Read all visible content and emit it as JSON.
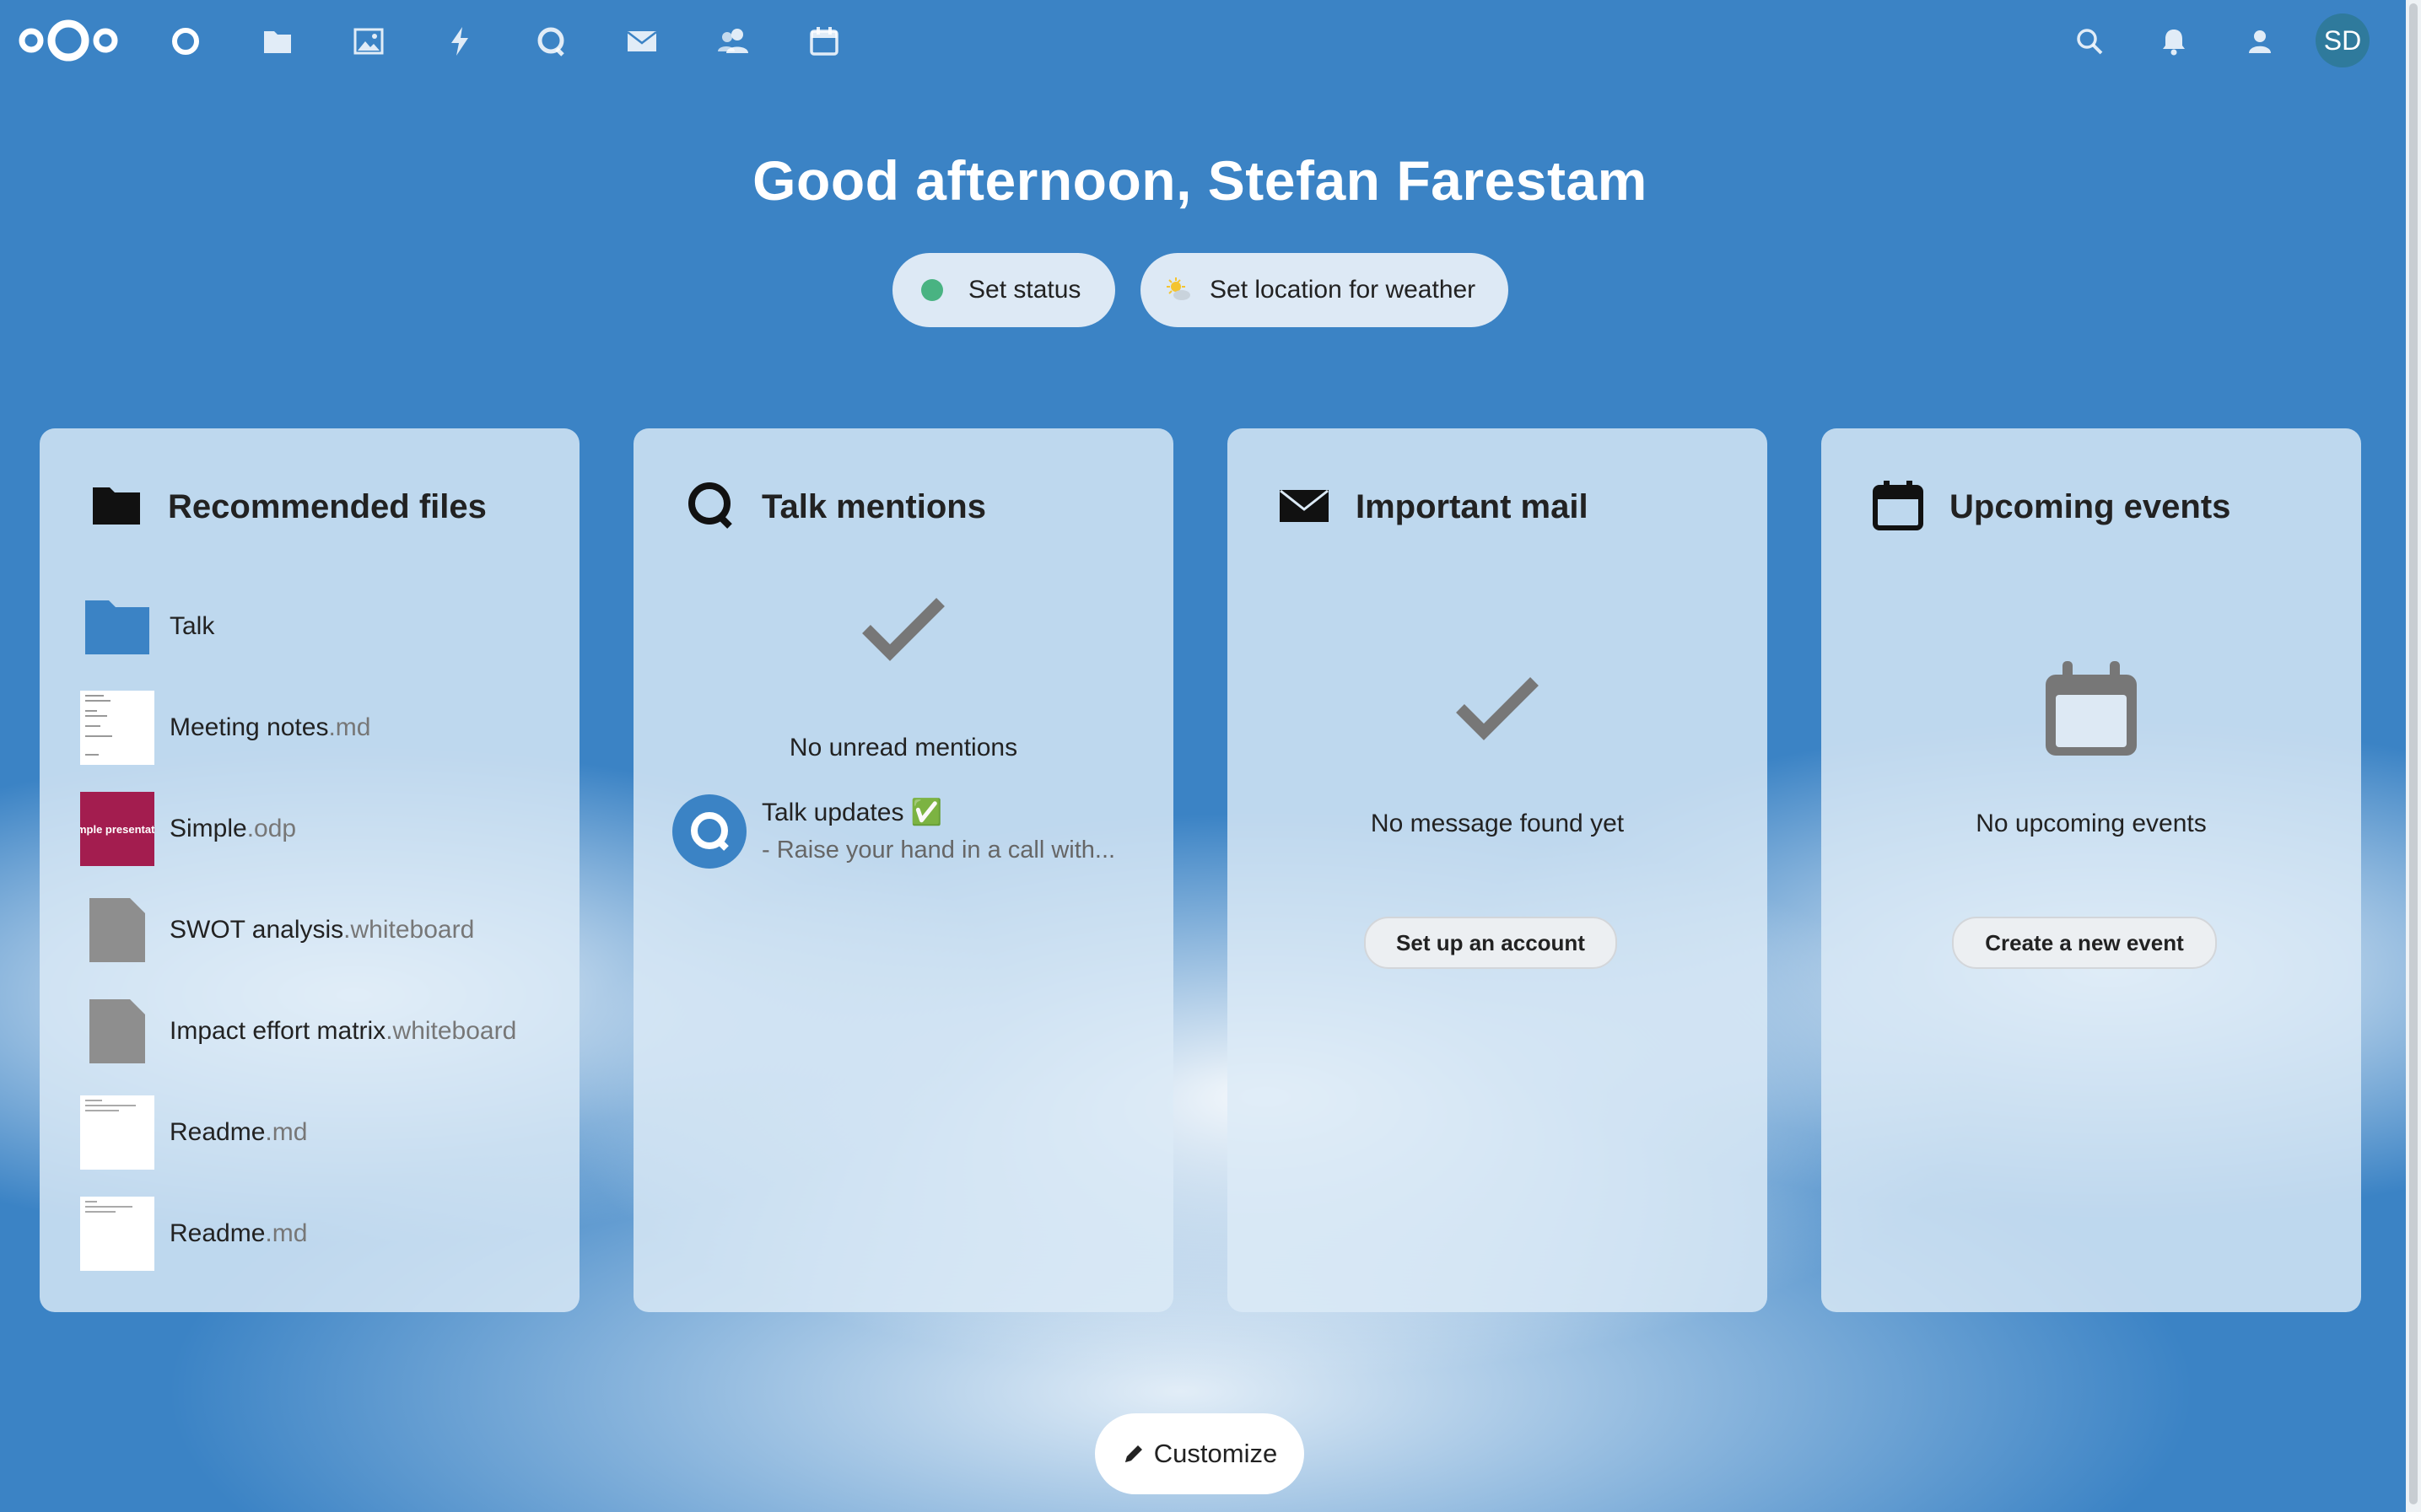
{
  "header": {
    "nav": [
      {
        "name": "dashboard-icon"
      },
      {
        "name": "files-icon"
      },
      {
        "name": "photos-icon"
      },
      {
        "name": "activity-icon"
      },
      {
        "name": "talk-icon"
      },
      {
        "name": "mail-icon"
      },
      {
        "name": "contacts-icon"
      },
      {
        "name": "calendar-icon"
      }
    ],
    "right_icons": [
      "search-icon",
      "notifications-icon",
      "contacts-menu-icon"
    ],
    "avatar_initials": "SD"
  },
  "greeting": "Good afternoon, Stefan Farestam",
  "status_button": "Set status",
  "weather_button": "Set location for weather",
  "widgets": {
    "files": {
      "title": "Recommended files",
      "items": [
        {
          "name": "Talk",
          "ext": ""
        },
        {
          "name": "Meeting notes",
          "ext": ".md"
        },
        {
          "name": "Simple",
          "ext": ".odp"
        },
        {
          "name": "SWOT analysis",
          "ext": ".whiteboard"
        },
        {
          "name": "Impact effort matrix",
          "ext": ".whiteboard"
        },
        {
          "name": "Readme",
          "ext": ".md"
        },
        {
          "name": "Readme",
          "ext": ".md"
        }
      ],
      "presentation_thumb_text": "mple presentati"
    },
    "talk": {
      "title": "Talk mentions",
      "empty": "No unread mentions",
      "item_title": "Talk updates ✅",
      "item_subtitle": "- Raise your hand in a call with..."
    },
    "mail": {
      "title": "Important mail",
      "empty": "No message found yet",
      "button": "Set up an account"
    },
    "calendar": {
      "title": "Upcoming events",
      "empty": "No upcoming events",
      "button": "Create a new event"
    }
  },
  "customize_button": "Customize",
  "colors": {
    "background": "#3b83c5",
    "accent": "#0082c9",
    "status_online": "#49b382"
  }
}
